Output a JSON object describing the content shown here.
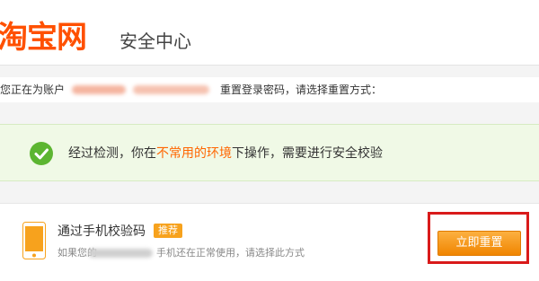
{
  "header": {
    "logo": "淘宝网",
    "title": "安全中心"
  },
  "account": {
    "prefix": "您正在为账户",
    "suffix": "重置登录密码，请选择重置方式："
  },
  "notice": {
    "icon": "check-circle-icon",
    "part1": "经过检测，你在",
    "highlight": "不常用的环境",
    "part2": "下操作，需要进行安全校验"
  },
  "option": {
    "icon": "mobile-phone-icon",
    "title": "通过手机校验码",
    "badge": "推荐",
    "desc_prefix": "如果您的",
    "desc_suffix": "手机还在正常使用，请选择此方式",
    "button": "立即重置"
  },
  "colors": {
    "brand": "#ff5000",
    "highlight": "#ff6600",
    "badge": "#f7a21d",
    "success": "#5cb531",
    "annotation": "#d91a1a"
  }
}
